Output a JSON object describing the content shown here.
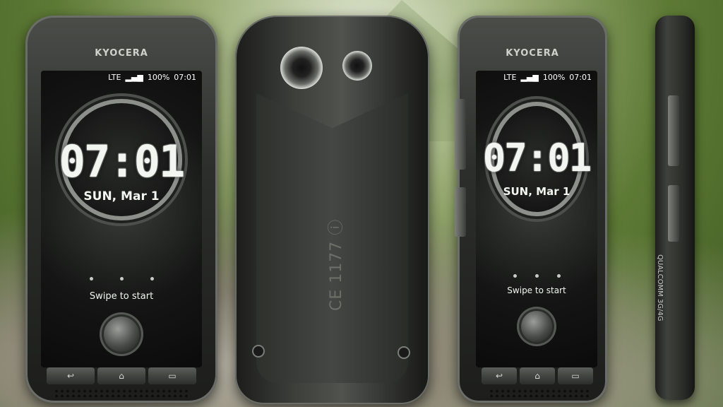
{
  "front_left": {
    "brand": "KYOCERA",
    "status": {
      "network": "LTE",
      "battery": "100%",
      "time": "07:01"
    },
    "clock": "07:01",
    "date": "SUN, Mar 1",
    "swipe_label": "Swipe to start",
    "nav": {
      "back": "↩",
      "home": "⌂",
      "recent": "▭"
    }
  },
  "front_right": {
    "brand": "KYOCERA",
    "status": {
      "network": "LTE",
      "battery": "100%",
      "time": "07:01"
    },
    "clock": "07:01",
    "date": "SUN, Mar 1",
    "swipe_label": "Swipe to start",
    "nav": {
      "back": "↩",
      "home": "⌂",
      "recent": "▭"
    }
  },
  "back": {
    "cert_mark": "CE 1177 ⓘ"
  },
  "side": {
    "chip_label": "QUALCOMM 3G/4G"
  }
}
